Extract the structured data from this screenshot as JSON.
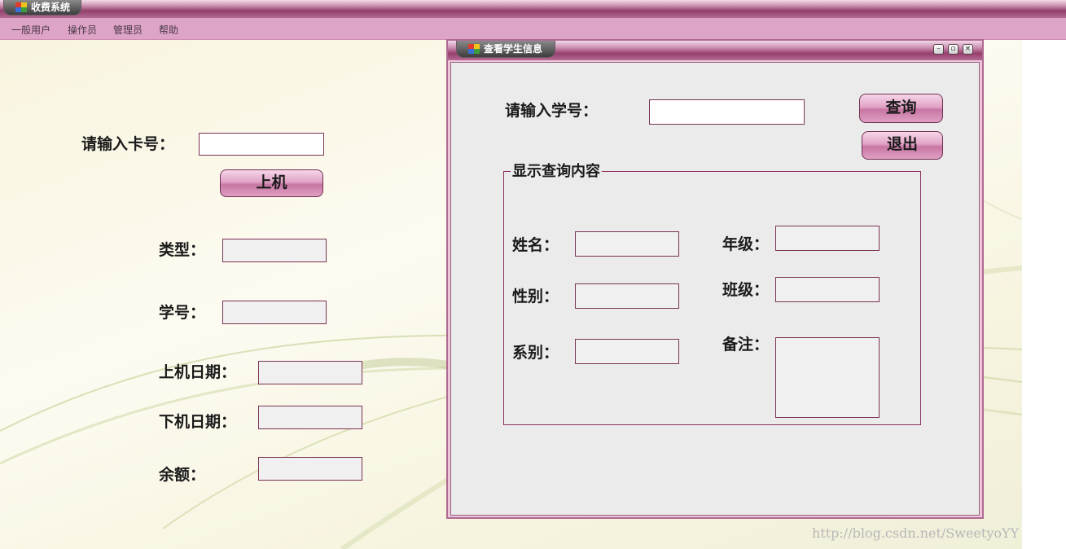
{
  "app": {
    "title": "收费系统"
  },
  "menu": {
    "items": [
      "一般用户",
      "操作员",
      "管理员",
      "帮助"
    ]
  },
  "main": {
    "card_label": "请输入卡号：",
    "login_button": "上机",
    "type_label": "类型：",
    "student_id_label": "学号：",
    "login_date_label": "上机日期：",
    "logout_date_label": "下机日期：",
    "balance_label": "余额："
  },
  "dialog": {
    "title": "查看学生信息",
    "student_id_label": "请输入学号：",
    "query_button": "查询",
    "exit_button": "退出",
    "group_title": "显示查询内容",
    "name_label": "姓名：",
    "gender_label": "性别：",
    "department_label": "系别：",
    "grade_label": "年级：",
    "class_label": "班级：",
    "remark_label": "备注："
  },
  "watermark": "http://blog.csdn.net/SweetyoYY",
  "colors": {
    "accent": "#92406b",
    "menubar": "#dea4c8",
    "field_border": "#7a3355"
  }
}
